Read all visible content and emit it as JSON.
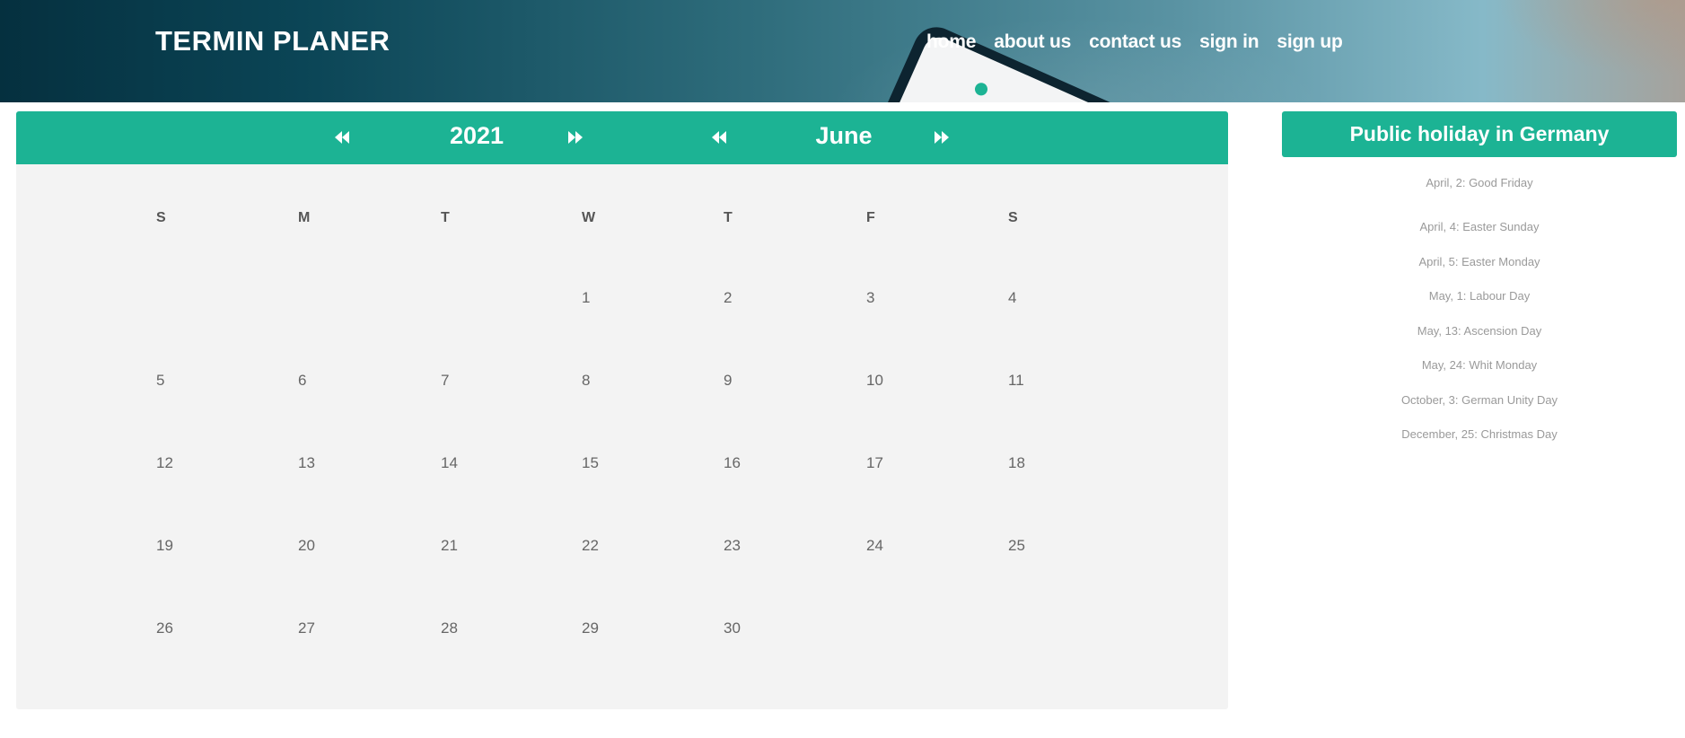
{
  "header": {
    "brand": "TERMIN PLANER",
    "nav": [
      "home",
      "about us",
      "contact us",
      "sign in",
      "sign up"
    ]
  },
  "calendar": {
    "year": "2021",
    "month": "June",
    "weekdays": [
      "S",
      "M",
      "T",
      "W",
      "T",
      "F",
      "S"
    ],
    "first_weekday_index": 3,
    "days_in_month": 30,
    "arrow_icons": [
      "double-chevron-left-icon",
      "double-chevron-right-icon"
    ]
  },
  "holidays": {
    "title": "Public holiday in Germany",
    "items": [
      "April, 2: Good Friday",
      "April, 4: Easter Sunday",
      "April, 5: Easter Monday",
      "May, 1: Labour Day",
      "May, 13: Ascension Day",
      "May, 24: Whit Monday",
      "October, 3: German Unity Day",
      "December, 25: Christmas Day"
    ]
  },
  "colors": {
    "accent": "#1cb394",
    "calendar_bg": "#f3f3f3",
    "header_dark": "#05303f"
  }
}
